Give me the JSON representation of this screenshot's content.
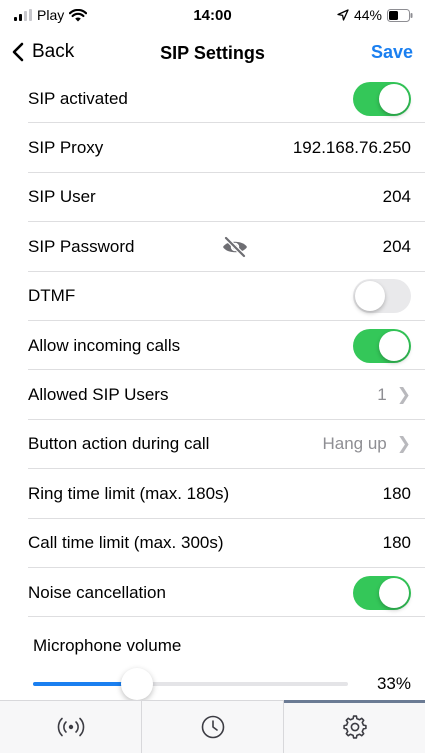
{
  "status_bar": {
    "carrier": "Play",
    "time": "14:00",
    "battery": "44%",
    "icons": [
      "signal-icon",
      "wifi-icon",
      "location-arrow-icon",
      "battery-icon"
    ]
  },
  "nav": {
    "back_label": "Back",
    "title": "SIP Settings",
    "save_label": "Save"
  },
  "settings": {
    "sip_activated": {
      "label": "SIP activated",
      "enabled": true
    },
    "sip_proxy": {
      "label": "SIP Proxy",
      "value": "192.168.76.250"
    },
    "sip_user": {
      "label": "SIP User",
      "value": "204"
    },
    "sip_password": {
      "label": "SIP Password",
      "value": "204",
      "icon": "eye-slash-icon"
    },
    "dtmf": {
      "label": "DTMF",
      "enabled": false
    },
    "allow_incoming_calls": {
      "label": "Allow incoming calls",
      "enabled": true
    },
    "allowed_sip_users": {
      "label": "Allowed SIP Users",
      "value": "1"
    },
    "button_action": {
      "label": "Button action during call",
      "value": "Hang up"
    },
    "ring_time_limit": {
      "label": "Ring time limit (max. 180s)",
      "value": "180"
    },
    "call_time_limit": {
      "label": "Call time limit (max. 300s)",
      "value": "180"
    },
    "noise_cancellation": {
      "label": "Noise cancellation",
      "enabled": true
    }
  },
  "volume": {
    "label": "Microphone volume",
    "value_text": "33%",
    "level": 0.33
  },
  "colors": {
    "accent": "#1a7ff0",
    "toggle_on": "#34c759",
    "toggle_off": "#e9e9eb",
    "active_tab_indicator": "#6b7b94"
  },
  "tabs": [
    {
      "icon": "broadcast-icon",
      "active": false
    },
    {
      "icon": "clock-icon",
      "active": false
    },
    {
      "icon": "gear-icon",
      "active": true
    }
  ]
}
